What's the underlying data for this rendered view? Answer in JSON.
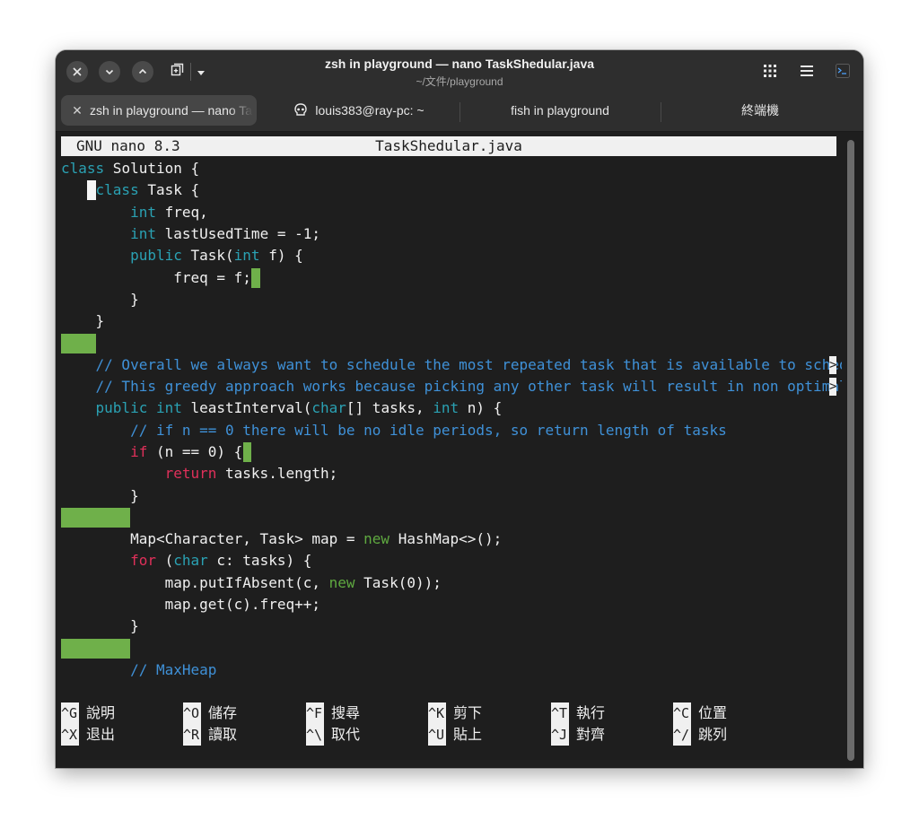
{
  "window": {
    "title": "zsh in playground — nano TaskShedular.java",
    "subtitle": "~/文件/playground"
  },
  "header_icons": [
    "close-icon",
    "minimize-icon",
    "maximize-icon",
    "new-tab-icon",
    "dropdown-arrow-icon",
    "grid-icon",
    "hamburger-menu-icon",
    "terminal-icon"
  ],
  "tabs": [
    {
      "label": "zsh in playground — nano TaskShedular.java",
      "active": true
    },
    {
      "label": "louis383@ray-pc: ~",
      "icon": "skull-icon"
    },
    {
      "label": "fish in playground"
    },
    {
      "label": "終端機"
    }
  ],
  "nano": {
    "version": "GNU nano 8.3",
    "filename": "TaskShedular.java"
  },
  "code_lines": [
    "class Solution {",
    "    class Task {",
    "        int freq,",
    "        int lastUsedTime = -1;",
    "        public Task(int f) {",
    "             freq = f;",
    "        }",
    "    }",
    "",
    "    // Overall we always want to schedule the most repeated task that is available to schedule",
    "    // This greedy approach works because picking any other task will result in non optimal so",
    "    public int leastInterval(char[] tasks, int n) {",
    "        // if n == 0 there will be no idle periods, so return length of tasks",
    "        if (n == 0) {",
    "            return tasks.length;",
    "        }",
    "",
    "        Map<Character, Task> map = new HashMap<>();",
    "        for (char c: tasks) {",
    "            map.putIfAbsent(c, new Task(0));",
    "            map.get(c).freq++;",
    "        }",
    "",
    "        // MaxHeap"
  ],
  "shortcuts": [
    [
      {
        "key": "^G",
        "label": "說明"
      },
      {
        "key": "^O",
        "label": "儲存"
      },
      {
        "key": "^F",
        "label": "搜尋"
      },
      {
        "key": "^K",
        "label": "剪下"
      },
      {
        "key": "^T",
        "label": "執行"
      },
      {
        "key": "^C",
        "label": "位置"
      }
    ],
    [
      {
        "key": "^X",
        "label": "退出"
      },
      {
        "key": "^R",
        "label": "讀取"
      },
      {
        "key": "^\\",
        "label": "取代"
      },
      {
        "key": "^U",
        "label": "貼上"
      },
      {
        "key": "^J",
        "label": "對齊"
      },
      {
        "key": "^/",
        "label": "跳列"
      }
    ]
  ],
  "colors": {
    "keyword_blue": "#2aa1b3",
    "keyword_green": "#5fa940",
    "keyword_red": "#e0305a",
    "comment": "#3f91d8",
    "whitespace_highlight": "#6fb04a"
  }
}
